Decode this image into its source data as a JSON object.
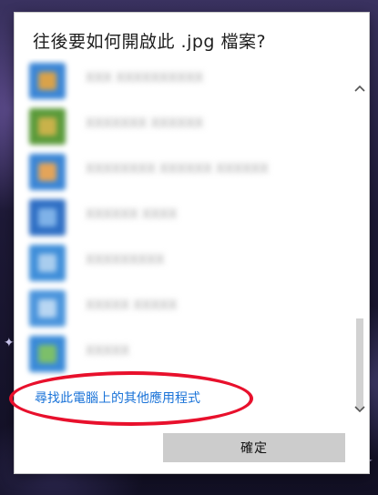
{
  "dialog": {
    "title": "往後要如何開啟此 .jpg 檔案?",
    "more_apps_link": "尋找此電腦上的其他應用程式",
    "ok_label": "確定"
  },
  "apps": [
    {
      "name": "App 1 (blurred)",
      "name_text": "XXX XXXXXXXXXX",
      "icon_color": "#3b86d6",
      "accent": "#d9a24a"
    },
    {
      "name": "App 2 (blurred)",
      "name_text": "XXXXXXX XXXXXX",
      "icon_color": "#5a9a3a",
      "accent": "#c9b24a"
    },
    {
      "name": "App 3 (blurred)",
      "name_text": "XXXXXXXX XXXXXX XXXXXX",
      "icon_color": "#3b86d6",
      "accent": "#e3a45a"
    },
    {
      "name": "App 4 (blurred)",
      "name_text": "XXXXXX XXXX",
      "icon_color": "#2f6fc4",
      "accent": "#7fb2e8"
    },
    {
      "name": "App 5 (blurred)",
      "name_text": "XXXXXXXXX",
      "icon_color": "#3f8ed9",
      "accent": "#a9cdee"
    },
    {
      "name": "App 6 (blurred)",
      "name_text": "XXXXX XXXXX",
      "icon_color": "#4a94dc",
      "accent": "#b8d6f2"
    },
    {
      "name": "App 7 (blurred)",
      "name_text": "XXXXX",
      "icon_color": "#3a8ad8",
      "accent": "#7cbf6a"
    }
  ],
  "scroll": {
    "position": 0.8
  },
  "colors": {
    "link": "#1a73d8",
    "annotation": "#e8102c",
    "button_bg": "#cccccc"
  }
}
